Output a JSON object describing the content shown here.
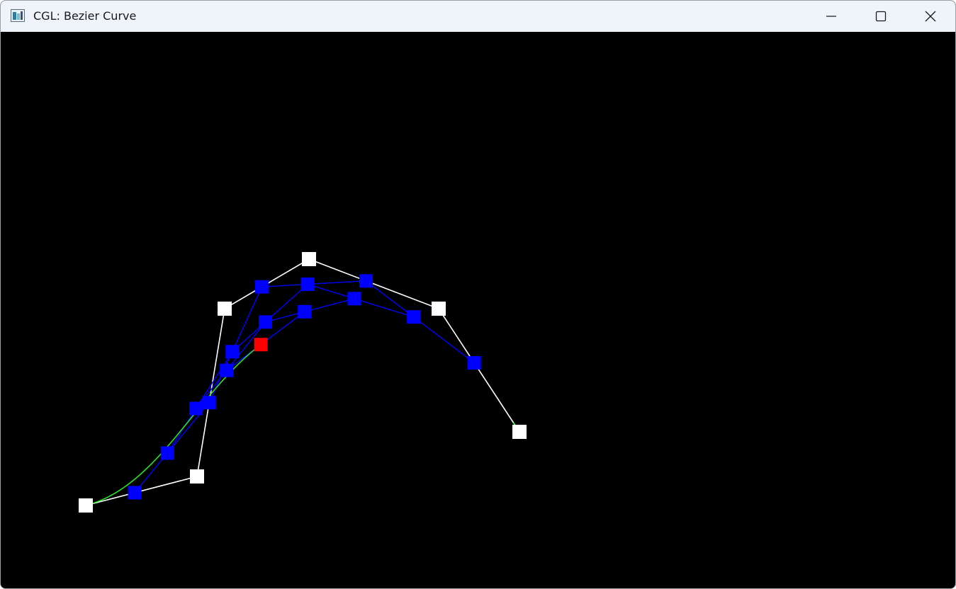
{
  "window": {
    "title": "CGL: Bezier Curve",
    "controls": [
      "minimize-button",
      "maximize-button",
      "close-button"
    ]
  },
  "colors": {
    "background": "#000000",
    "control_polygon": "#ffffff",
    "control_point": "#ffffff",
    "construction_line": "#0000ff",
    "construction_point": "#0000ff",
    "current_point": "#ff0000",
    "curve": "#22ee22"
  },
  "icons": {
    "app": "app-window-icon",
    "minimize": "minimize-icon",
    "maximize": "maximize-icon",
    "close": "close-icon"
  }
}
